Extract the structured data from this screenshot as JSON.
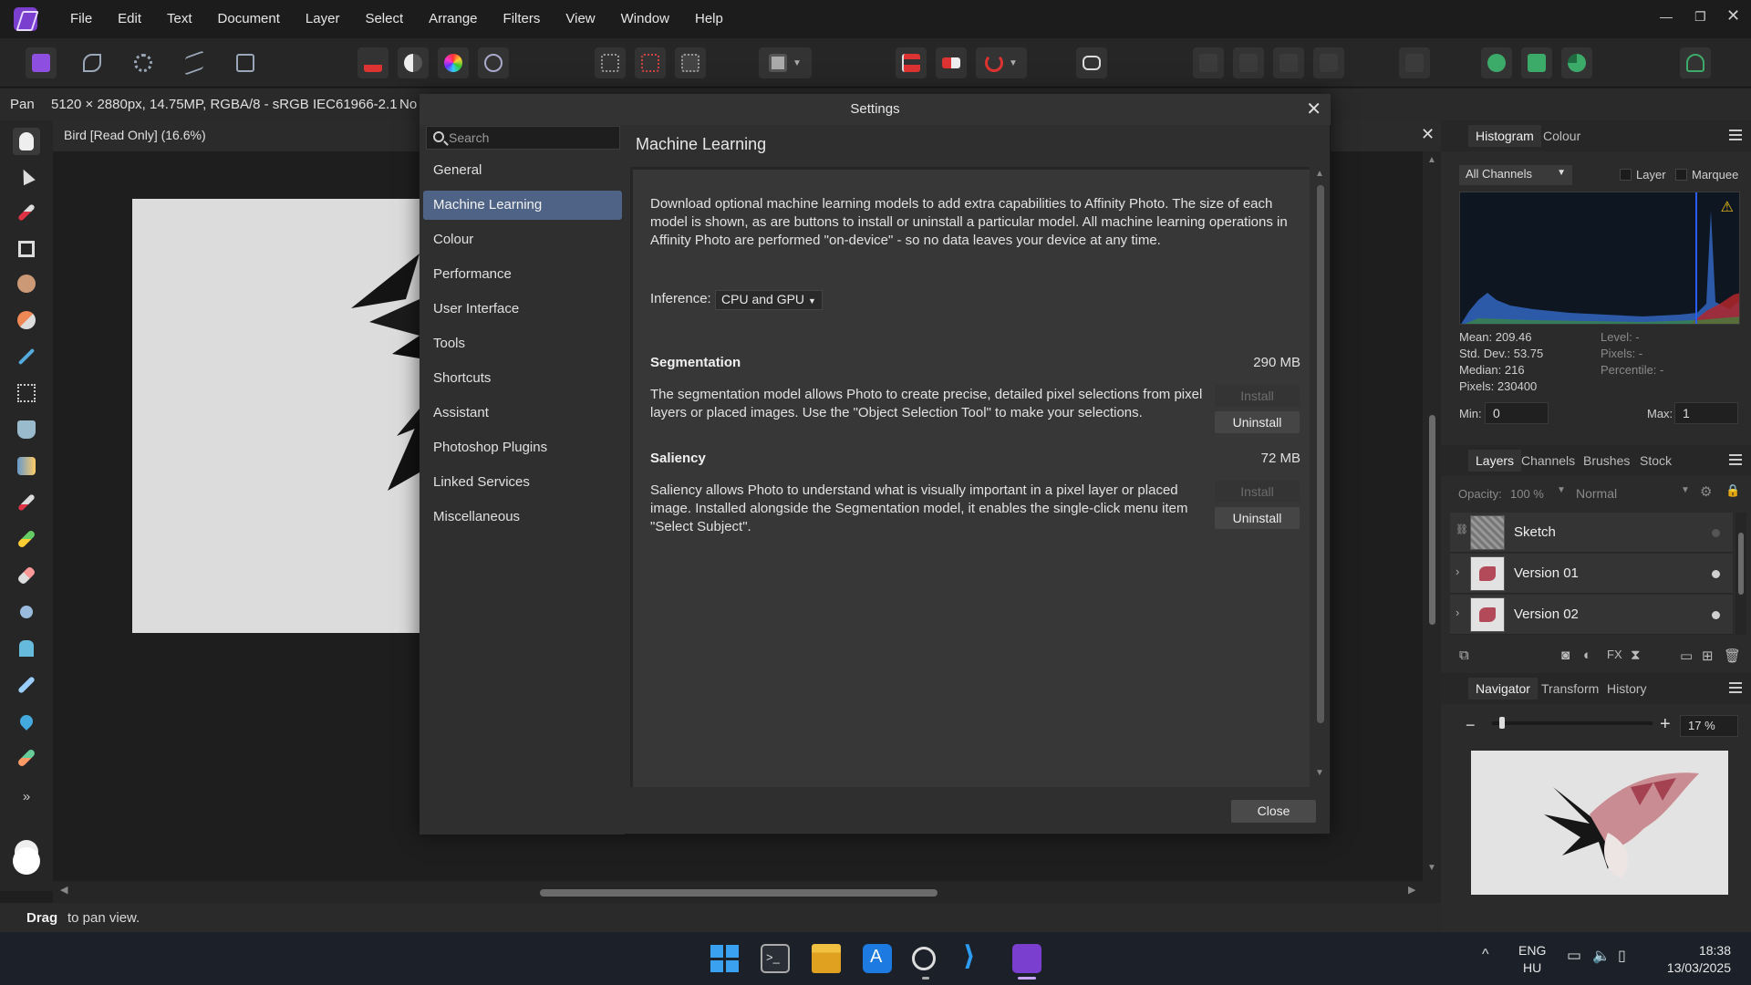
{
  "menubar": {
    "items": [
      "File",
      "Edit",
      "Text",
      "Document",
      "Layer",
      "Select",
      "Arrange",
      "Filters",
      "View",
      "Window",
      "Help"
    ]
  },
  "context": {
    "tool": "Pan",
    "doc_info": "5120 × 2880px, 14.75MP, RGBA/8 - sRGB IEC61966-2.1",
    "extra": "No"
  },
  "document": {
    "tab_title": "Bird [Read Only] (16.6%)"
  },
  "status": {
    "bold": "Drag",
    "rest": "to pan view."
  },
  "settings": {
    "title": "Settings",
    "search_placeholder": "Search",
    "categories": [
      "General",
      "Machine Learning",
      "Colour",
      "Performance",
      "User Interface",
      "Tools",
      "Shortcuts",
      "Assistant",
      "Photoshop Plugins",
      "Linked Services",
      "Miscellaneous"
    ],
    "selected_category": "Machine Learning",
    "pane_title": "Machine Learning",
    "intro_lines": [
      "Download optional machine learning models to add extra capabilities to Affinity Photo. The size of each",
      "model is shown, as are buttons to install or uninstall a particular model. All machine learning operations in",
      "Affinity Photo are performed \"on-device\" - so no data leaves your device at any time."
    ],
    "inference_label": "Inference:",
    "inference_value": "CPU and GPU",
    "models": [
      {
        "name": "Segmentation",
        "size": "290 MB",
        "desc_lines": [
          "The segmentation model allows Photo to create precise, detailed pixel selections from pixel",
          "layers or placed images. Use the \"Object Selection Tool\" to make your selections."
        ],
        "install": "Install",
        "uninstall": "Uninstall"
      },
      {
        "name": "Saliency",
        "size": "72 MB",
        "desc_lines": [
          "Saliency allows Photo to understand what is visually important in a pixel layer or placed",
          "image. Installed alongside the Segmentation model, it enables the single-click menu item",
          "\"Select Subject\"."
        ],
        "install": "Install",
        "uninstall": "Uninstall"
      }
    ],
    "close_label": "Close"
  },
  "histogram": {
    "tabs": [
      "Histogram",
      "Colour"
    ],
    "channel": "All Channels",
    "layer_label": "Layer",
    "marquee_label": "Marquee",
    "stats_left": [
      "Mean: 209.46",
      "Std. Dev.: 53.75",
      "Median: 216",
      "Pixels: 230400"
    ],
    "stats_right": [
      "Level: -",
      "Pixels: -",
      "Percentile: -"
    ],
    "min_label": "Min:",
    "min_value": "0",
    "max_label": "Max:",
    "max_value": "1"
  },
  "layers": {
    "tabs": [
      "Layers",
      "Channels",
      "Brushes",
      "Stock"
    ],
    "opacity_label": "Opacity:",
    "opacity_value": "100 %",
    "blend_mode": "Normal",
    "items": [
      "Sketch",
      "Version 01",
      "Version 02"
    ]
  },
  "navigator": {
    "tabs": [
      "Navigator",
      "Transform",
      "History"
    ],
    "zoom": "17 %"
  },
  "taskbar": {
    "lang_top": "ENG",
    "lang_bottom": "HU",
    "time": "18:38",
    "date": "13/03/2025"
  },
  "colors": {
    "accent_selected": "#4e6385",
    "app_purple": "#7b3fd0"
  }
}
